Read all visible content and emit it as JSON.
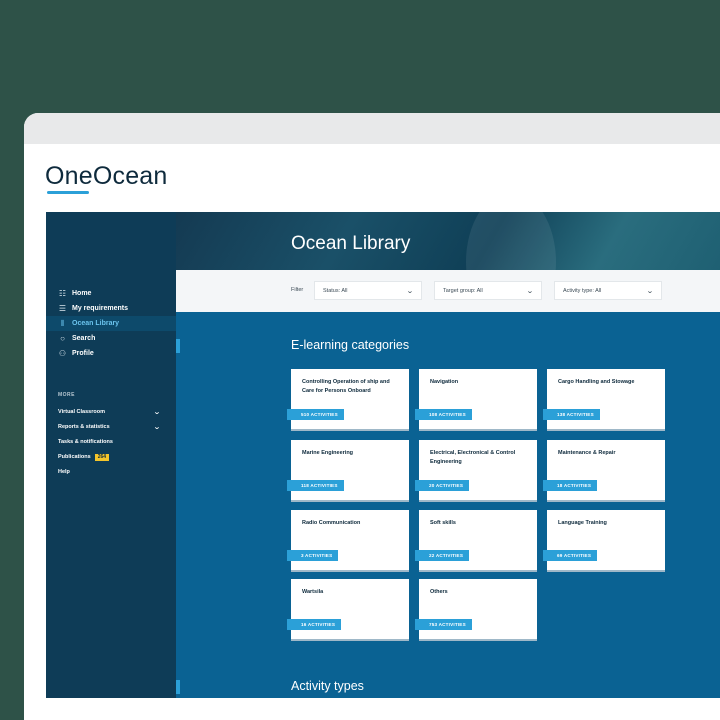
{
  "brand": {
    "logo": "OneOcean"
  },
  "sidebar": {
    "nav": [
      {
        "label": "Home",
        "icon": "☷"
      },
      {
        "label": "My requirements",
        "icon": "☰"
      },
      {
        "label": "Ocean Library",
        "icon": "⫴"
      },
      {
        "label": "Search",
        "icon": "○"
      },
      {
        "label": "Profile",
        "icon": "⚇"
      }
    ],
    "more_label": "MORE",
    "more": [
      {
        "label": "Virtual Classroom",
        "chevron": "⌄"
      },
      {
        "label": "Reports & statistics",
        "chevron": "⌄"
      },
      {
        "label": "Tasks & notifications"
      },
      {
        "label": "Publications",
        "badge": "264"
      },
      {
        "label": "Help"
      }
    ]
  },
  "hero": {
    "title": "Ocean Library"
  },
  "filters": {
    "label": "Filter",
    "status": "Status: All",
    "target_group": "Target group: All",
    "activity_type": "Activity type: All"
  },
  "sections": {
    "elearning": "E-learning categories",
    "activity_types": "Activity types"
  },
  "categories": [
    {
      "title": "Controlling Operation of ship and Care for Persons Onboard",
      "count": "510 ACTIVITIES"
    },
    {
      "title": "Navigation",
      "count": "108 ACTIVITIES"
    },
    {
      "title": "Cargo Handling and Stowage",
      "count": "138 ACTIVITIES"
    },
    {
      "title": "Marine Engineering",
      "count": "118 ACTIVITIES"
    },
    {
      "title": "Electrical, Electronical & Control Engineering",
      "count": "20 ACTIVITIES"
    },
    {
      "title": "Maintenance & Repair",
      "count": "18 ACTIVITIES"
    },
    {
      "title": "Radio Communication",
      "count": "3 ACTIVITIES"
    },
    {
      "title": "Soft skills",
      "count": "22 ACTIVITIES"
    },
    {
      "title": "Language Training",
      "count": "69 ACTIVITIES"
    },
    {
      "title": "Wartsila",
      "count": "16 ACTIVITIES"
    },
    {
      "title": "Others",
      "count": "753 ACTIVITIES"
    }
  ]
}
